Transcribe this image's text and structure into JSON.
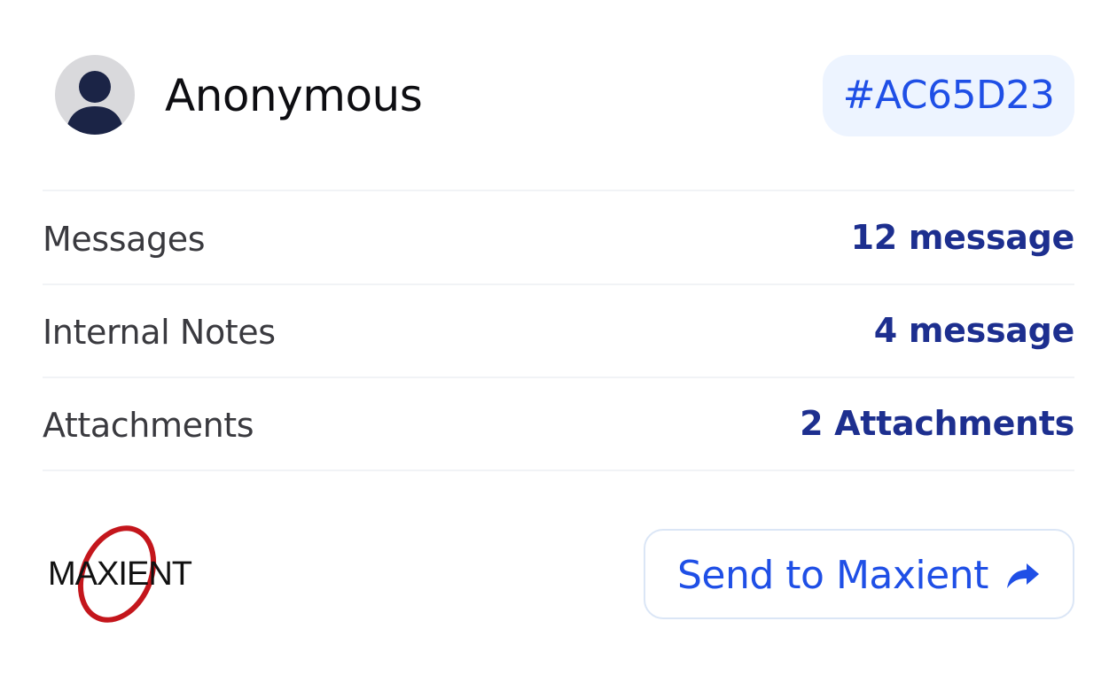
{
  "user": {
    "name": "Anonymous",
    "avatar_icon": "user-avatar-icon",
    "case_id": "#AC65D23"
  },
  "stats": [
    {
      "label": "Messages",
      "value": "12 message"
    },
    {
      "label": "Internal Notes",
      "value": "4 message"
    },
    {
      "label": "Attachments",
      "value": "2 Attachments"
    }
  ],
  "footer": {
    "logo_text": "MAXIENT",
    "send_button_label": "Send to Maxient",
    "send_icon": "share-arrow-icon"
  },
  "colors": {
    "accent": "#1f4fe6",
    "value_text": "#1d2f8f",
    "badge_bg": "#edf4ff",
    "avatar_bg": "#d9d9dc",
    "avatar_figure": "#1b2446",
    "logo_ring": "#c4161c"
  }
}
